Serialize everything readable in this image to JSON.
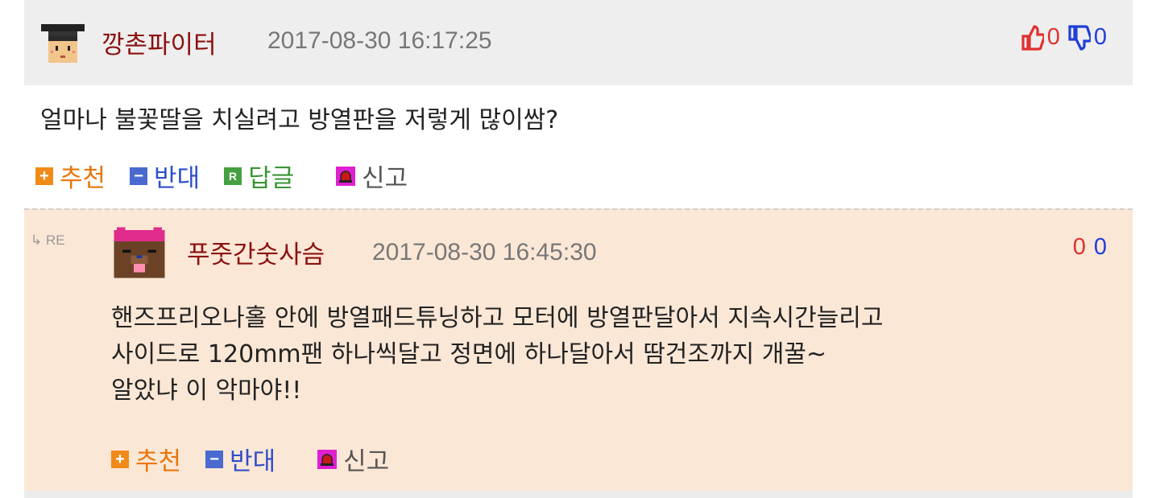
{
  "comment": {
    "author": "깡촌파이터",
    "date": "2017-08-30 16:17:25",
    "likes": "0",
    "dislikes": "0",
    "body": "얼마나 불꽃딸을 치실려고 방열판을 저렇게 많이쌈?",
    "actions": {
      "recommend": "추천",
      "oppose": "반대",
      "reply": "답글",
      "report": "신고"
    }
  },
  "reply": {
    "re_mark": "RE",
    "author": "푸줏간숫사슴",
    "date": "2017-08-30 16:45:30",
    "likes": "0",
    "dislikes": "0",
    "body_lines": [
      "핸즈프리오나홀 안에 방열패드튜닝하고 모터에 방열판달아서 지속시간늘리고",
      "사이드로 120mm팬 하나씩달고 정면에 하나달아서 땀건조까지 개꿀~",
      "알았냐 이 악마야!!"
    ],
    "actions": {
      "recommend": "추천",
      "oppose": "반대",
      "report": "신고"
    }
  },
  "colors": {
    "author": "#8b1010",
    "like": "#e03030",
    "dislike": "#1f3fd8",
    "reply_bg": "#fbe7d6"
  },
  "icons": [
    "graduate-avatar-icon",
    "thumbs-up-icon",
    "thumbs-down-icon",
    "plus-icon",
    "minus-icon",
    "reply-icon",
    "siren-icon",
    "re-arrow-icon",
    "bear-avatar-icon"
  ]
}
